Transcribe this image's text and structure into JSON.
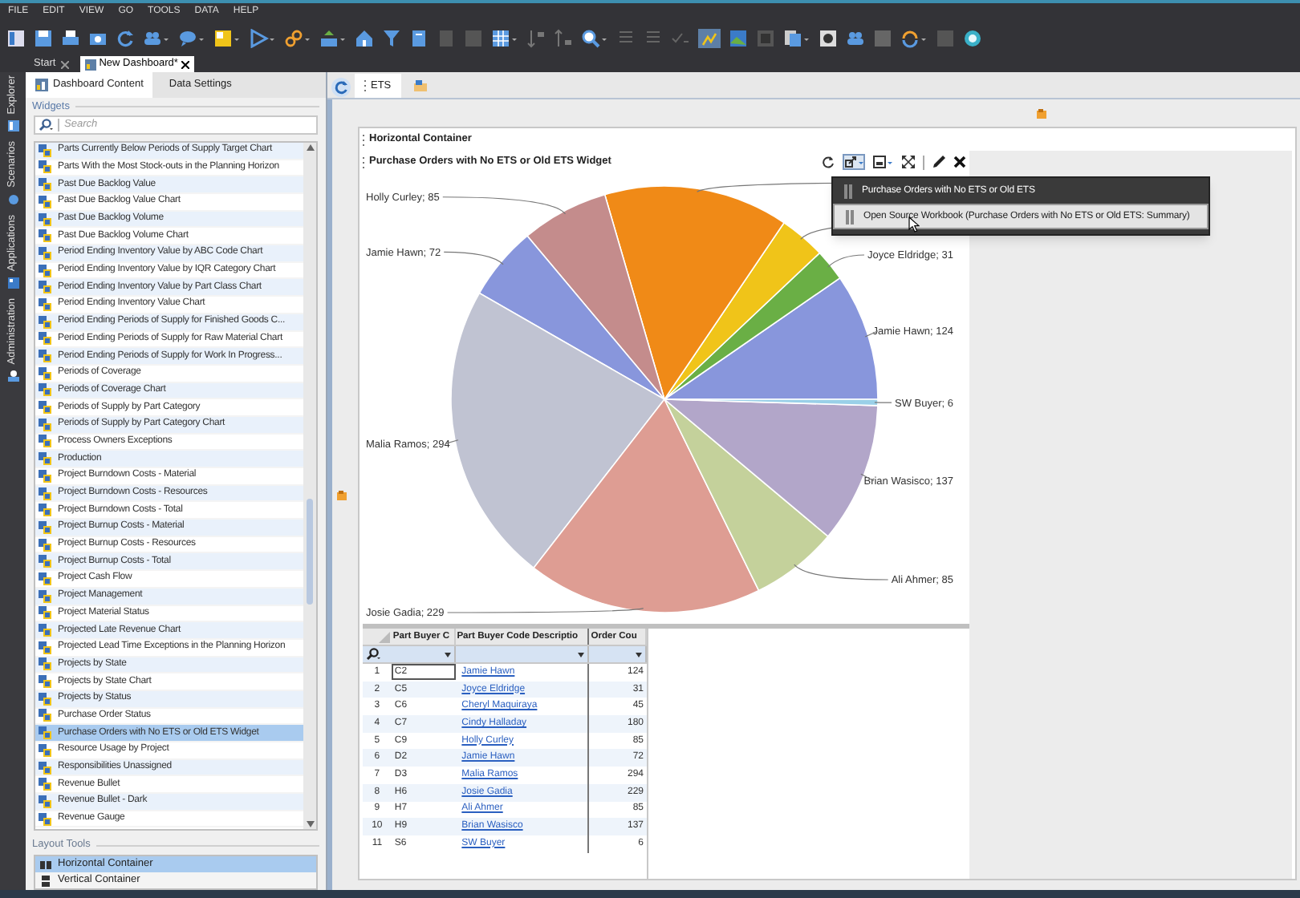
{
  "menu": [
    "FILE",
    "EDIT",
    "VIEW",
    "GO",
    "TOOLS",
    "DATA",
    "HELP"
  ],
  "doc_tabs": [
    {
      "label": "Start",
      "selected": false
    },
    {
      "label": "New Dashboard*",
      "selected": true
    }
  ],
  "side_nav": [
    {
      "label": "Explorer"
    },
    {
      "label": "Scenarios"
    },
    {
      "label": "Applications"
    },
    {
      "label": "Administration"
    }
  ],
  "panel_tabs": [
    {
      "label": "Dashboard Content",
      "selected": true
    },
    {
      "label": "Data Settings",
      "selected": false
    }
  ],
  "widgets": {
    "heading": "Widgets",
    "search": {
      "placeholder": "Search"
    },
    "items": [
      {
        "label": "Parts Currently Below Periods of Supply Target Chart",
        "selected": false
      },
      {
        "label": "Parts With the Most Stock-outs in the Planning Horizon",
        "selected": false
      },
      {
        "label": "Past Due Backlog Value",
        "selected": false
      },
      {
        "label": "Past Due Backlog Value Chart",
        "selected": false
      },
      {
        "label": "Past Due Backlog Volume",
        "selected": false
      },
      {
        "label": "Past Due Backlog Volume Chart",
        "selected": false
      },
      {
        "label": "Period Ending Inventory Value by ABC Code Chart",
        "selected": false
      },
      {
        "label": "Period Ending Inventory Value by IQR Category Chart",
        "selected": false
      },
      {
        "label": "Period Ending Inventory Value by Part Class Chart",
        "selected": false
      },
      {
        "label": "Period Ending Inventory Value Chart",
        "selected": false
      },
      {
        "label": "Period Ending Periods of Supply for Finished Goods C...",
        "selected": false
      },
      {
        "label": "Period Ending Periods of Supply for Raw Material Chart",
        "selected": false
      },
      {
        "label": "Period Ending Periods of Supply for Work In Progress...",
        "selected": false
      },
      {
        "label": "Periods of Coverage",
        "selected": false
      },
      {
        "label": "Periods of Coverage Chart",
        "selected": false
      },
      {
        "label": "Periods of Supply by Part Category",
        "selected": false
      },
      {
        "label": "Periods of Supply by Part Category Chart",
        "selected": false
      },
      {
        "label": "Process Owners Exceptions",
        "selected": false
      },
      {
        "label": "Production",
        "selected": false
      },
      {
        "label": "Project Burndown Costs - Material",
        "selected": false
      },
      {
        "label": "Project Burndown Costs - Resources",
        "selected": false
      },
      {
        "label": "Project Burndown Costs - Total",
        "selected": false
      },
      {
        "label": "Project Burnup Costs - Material",
        "selected": false
      },
      {
        "label": "Project Burnup Costs - Resources",
        "selected": false
      },
      {
        "label": "Project Burnup Costs - Total",
        "selected": false
      },
      {
        "label": "Project Cash Flow",
        "selected": false
      },
      {
        "label": "Project Management",
        "selected": false
      },
      {
        "label": "Project Material Status",
        "selected": false
      },
      {
        "label": "Projected Late Revenue Chart",
        "selected": false
      },
      {
        "label": "Projected Lead Time Exceptions in the Planning Horizon",
        "selected": false
      },
      {
        "label": "Projects by State",
        "selected": false
      },
      {
        "label": "Projects by State Chart",
        "selected": false
      },
      {
        "label": "Projects by Status",
        "selected": false
      },
      {
        "label": "Purchase Order Status",
        "selected": false
      },
      {
        "label": "Purchase Orders with No ETS or Old ETS Widget",
        "selected": true
      },
      {
        "label": "Resource Usage by Project",
        "selected": false
      },
      {
        "label": "Responsibilities Unassigned",
        "selected": false
      },
      {
        "label": "Revenue Bullet",
        "selected": false
      },
      {
        "label": "Revenue Bullet - Dark",
        "selected": false
      },
      {
        "label": "Revenue Gauge",
        "selected": false
      }
    ]
  },
  "layout_tools": {
    "heading": "Layout Tools",
    "items": [
      {
        "label": "Horizontal Container",
        "selected": true
      },
      {
        "label": "Vertical Container",
        "selected": false
      }
    ]
  },
  "view_tabs": [
    {
      "label": "ETS",
      "selected": true
    },
    {
      "selected": false
    }
  ],
  "container": {
    "title": "Horizontal Container"
  },
  "widget": {
    "title": "Purchase Orders with No ETS or Old ETS Widget",
    "chart_data": {
      "type": "pie",
      "series": [
        {
          "values": [
            9.63,
            2.41,
            3.49,
            13.98,
            6.6,
            5.59,
            22.81,
            17.78,
            6.6,
            10.64,
            0.47
          ]
        }
      ],
      "colors": [
        "#8896dc",
        "#6aaf45",
        "#f0c419",
        "#f08a17",
        "#c48c8c",
        "#8896dc",
        "#c0c3d2",
        "#de9d93",
        "#c4d19b",
        "#b2a6c9",
        "#9ad0e8"
      ],
      "value_labels": [
        "Jamie Hawn; 124",
        "Joyce Eldridge; 31",
        null,
        null,
        "Holly Curley; 85",
        "Jamie Hawn; 72",
        "Malia Ramos; 294",
        "Josie Gadia; 229",
        "Ali Ahmer; 85",
        "Brian Wasisco; 137",
        "SW Buyer; 6"
      ]
    }
  },
  "popup_menu": {
    "items": [
      {
        "label": "Purchase Orders with No ETS or Old ETS",
        "selected": false
      },
      {
        "label": "Open Source Workbook (Purchase Orders with No ETS or Old ETS: Summary)",
        "selected": true
      }
    ]
  },
  "grid": {
    "columns": [
      "Part Buyer C",
      "Part Buyer Code Descriptio",
      "Order Cou"
    ],
    "rows": [
      {
        "number": "1",
        "cells": [
          "C2",
          "Jamie Hawn",
          "124"
        ],
        "focused": true
      },
      {
        "number": "2",
        "cells": [
          "C5",
          "Joyce Eldridge",
          "31"
        ],
        "focused": false
      },
      {
        "number": "3",
        "cells": [
          "C6",
          "Cheryl Maquiraya",
          "45"
        ],
        "focused": false
      },
      {
        "number": "4",
        "cells": [
          "C7",
          "Cindy Halladay",
          "180"
        ],
        "focused": false
      },
      {
        "number": "5",
        "cells": [
          "C9",
          "Holly Curley",
          "85"
        ],
        "focused": false
      },
      {
        "number": "6",
        "cells": [
          "D2",
          "Jamie Hawn",
          "72"
        ],
        "focused": false
      },
      {
        "number": "7",
        "cells": [
          "D3",
          "Malia Ramos",
          "294"
        ],
        "focused": false
      },
      {
        "number": "8",
        "cells": [
          "H6",
          "Josie Gadia",
          "229"
        ],
        "focused": false
      },
      {
        "number": "9",
        "cells": [
          "H7",
          "Ali Ahmer",
          "85"
        ],
        "focused": false
      },
      {
        "number": "10",
        "cells": [
          "H9",
          "Brian Wasisco",
          "137"
        ],
        "focused": false
      },
      {
        "number": "11",
        "cells": [
          "S6",
          "SW Buyer",
          "6"
        ],
        "focused": false
      }
    ]
  }
}
